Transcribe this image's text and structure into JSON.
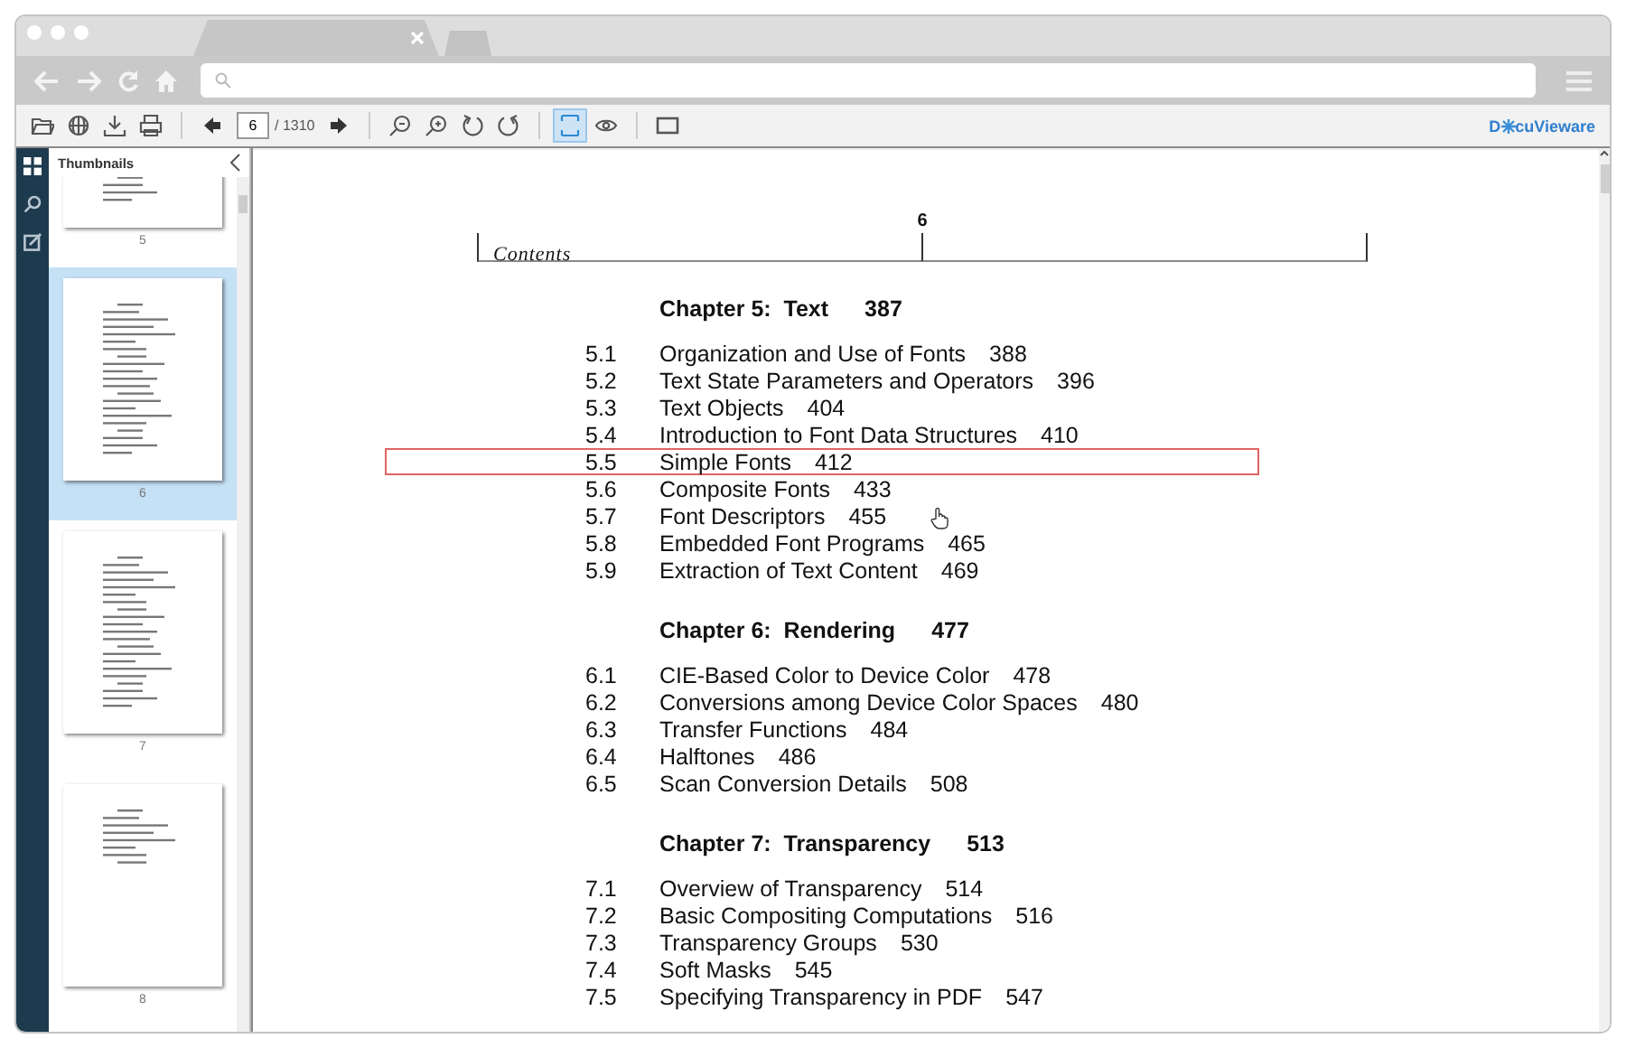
{
  "toolbar": {
    "buttons": [
      {
        "kind": "open",
        "selected": false
      },
      {
        "kind": "web",
        "selected": false
      },
      {
        "kind": "download",
        "selected": false
      },
      {
        "kind": "print",
        "selected": false
      },
      {
        "kind": "prev",
        "selected": false
      },
      {
        "kind": "next",
        "selected": false
      },
      {
        "kind": "zoom-out",
        "selected": false
      },
      {
        "kind": "zoom-in",
        "selected": false
      },
      {
        "kind": "rotate-left",
        "selected": false
      },
      {
        "kind": "rotate-right",
        "selected": false
      },
      {
        "kind": "fit-width",
        "selected": true
      },
      {
        "kind": "view",
        "selected": false
      },
      {
        "kind": "select-area",
        "selected": false
      }
    ],
    "page_input": "6",
    "page_total": "/ 1310",
    "logo": {
      "before": "D",
      "after": "cuVieware"
    }
  },
  "sidebar": {
    "tools": [
      {
        "kind": "thumbnails",
        "selected": true
      },
      {
        "kind": "search",
        "selected": false
      },
      {
        "kind": "annotate",
        "selected": false
      }
    ],
    "title": "Thumbnails",
    "thumbnails": [
      {
        "label": "5",
        "selected": false
      },
      {
        "label": "6",
        "selected": true
      },
      {
        "label": "7",
        "selected": false
      },
      {
        "label": "8",
        "selected": false
      }
    ]
  },
  "document": {
    "running_title": "Contents",
    "page_number": "6",
    "chapters": [
      {
        "title": "Chapter 5:  Text",
        "page": "387",
        "entries": [
          {
            "number": "5.1",
            "title": "Organization and Use of Fonts",
            "page": "388",
            "highlighted": false
          },
          {
            "number": "5.2",
            "title": "Text State Parameters and Operators",
            "page": "396",
            "highlighted": false
          },
          {
            "number": "5.3",
            "title": "Text Objects",
            "page": "404",
            "highlighted": false
          },
          {
            "number": "5.4",
            "title": "Introduction to Font Data Structures",
            "page": "410",
            "highlighted": false
          },
          {
            "number": "5.5",
            "title": "Simple Fonts",
            "page": "412",
            "highlighted": true
          },
          {
            "number": "5.6",
            "title": "Composite Fonts",
            "page": "433",
            "highlighted": false
          },
          {
            "number": "5.7",
            "title": "Font Descriptors",
            "page": "455",
            "highlighted": false
          },
          {
            "number": "5.8",
            "title": "Embedded Font Programs",
            "page": "465",
            "highlighted": false
          },
          {
            "number": "5.9",
            "title": "Extraction of Text Content",
            "page": "469",
            "highlighted": false
          }
        ]
      },
      {
        "title": "Chapter 6:  Rendering",
        "page": "477",
        "entries": [
          {
            "number": "6.1",
            "title": "CIE-Based Color to Device Color",
            "page": "478",
            "highlighted": false
          },
          {
            "number": "6.2",
            "title": "Conversions among Device Color Spaces",
            "page": "480",
            "highlighted": false
          },
          {
            "number": "6.3",
            "title": "Transfer Functions",
            "page": "484",
            "highlighted": false
          },
          {
            "number": "6.4",
            "title": "Halftones",
            "page": "486",
            "highlighted": false
          },
          {
            "number": "6.5",
            "title": "Scan Conversion Details",
            "page": "508",
            "highlighted": false
          }
        ]
      },
      {
        "title": "Chapter 7:  Transparency",
        "page": "513",
        "entries": [
          {
            "number": "7.1",
            "title": "Overview of Transparency",
            "page": "514",
            "highlighted": false
          },
          {
            "number": "7.2",
            "title": "Basic Compositing Computations",
            "page": "516",
            "highlighted": false
          },
          {
            "number": "7.3",
            "title": "Transparency Groups",
            "page": "530",
            "highlighted": false
          },
          {
            "number": "7.4",
            "title": "Soft Masks",
            "page": "545",
            "highlighted": false
          },
          {
            "number": "7.5",
            "title": "Specifying Transparency in PDF",
            "page": "547",
            "highlighted": false
          }
        ]
      }
    ]
  }
}
